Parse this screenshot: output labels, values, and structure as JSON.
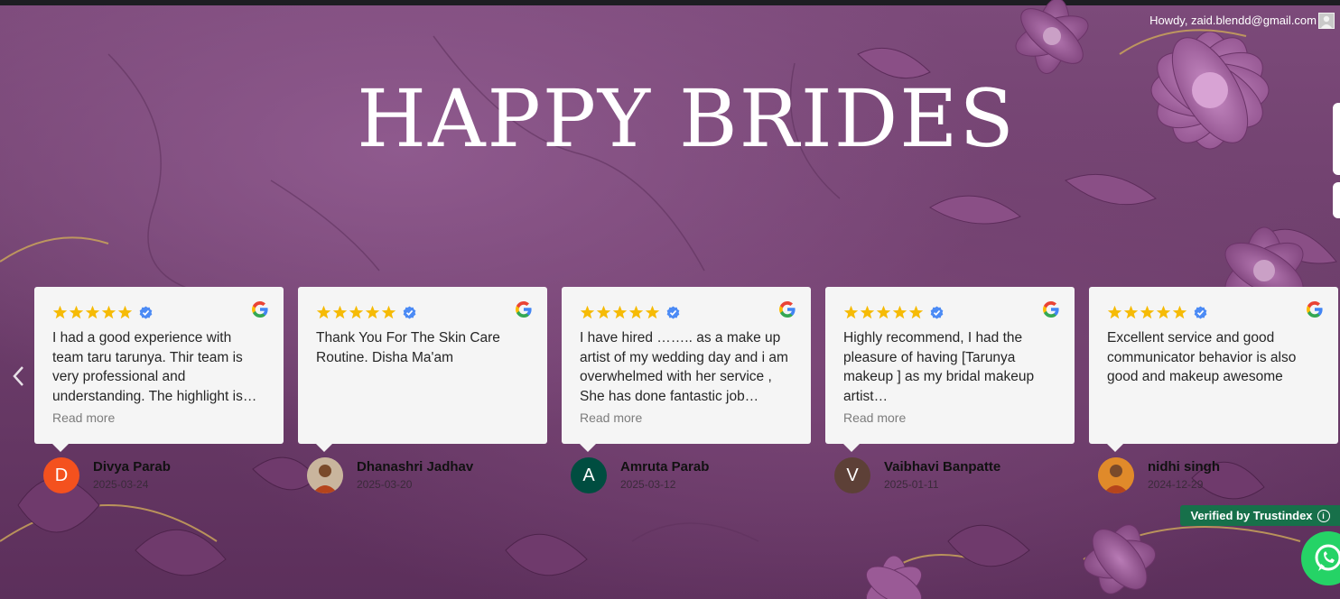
{
  "header": {
    "greeting": "Howdy, zaid.blendd@gmail.com"
  },
  "section": {
    "title": "HAPPY BRIDES"
  },
  "colors": {
    "background": "#6e3f6c",
    "card": "#f5f5f5",
    "star": "#f6bb06",
    "verified_blue": "#4c8bf5",
    "trustindex_green": "#17704a",
    "whatsapp_green": "#25d366"
  },
  "carousel": {
    "prev_icon": "chevron-left-icon",
    "reviews": [
      {
        "rating": 5,
        "text": "I had a good experience with team taru tarunya. Thir team is very professional and understanding. The highlight is…",
        "read_more": "Read more",
        "reviewer": "Divya Parab",
        "date": "2025-03-24",
        "avatar_initial": "D",
        "avatar_color": "#f4511e"
      },
      {
        "rating": 5,
        "text": "Thank You For The Skin Care Routine. Disha Ma'am",
        "read_more": "",
        "reviewer": "Dhanashri Jadhav",
        "date": "2025-03-20",
        "avatar_initial": "",
        "avatar_color": "#c9b59d"
      },
      {
        "rating": 5,
        "text": "I have hired …….. as a make up artist of my wedding day and i am overwhelmed with her service , She has done fantastic job…",
        "read_more": "Read more",
        "reviewer": "Amruta Parab",
        "date": "2025-03-12",
        "avatar_initial": "A",
        "avatar_color": "#004d40"
      },
      {
        "rating": 5,
        "text": "Highly recommend, I had the pleasure of having [Tarunya makeup ] as my bridal makeup artist…",
        "read_more": "Read more",
        "reviewer": "Vaibhavi Banpatte",
        "date": "2025-01-11",
        "avatar_initial": "V",
        "avatar_color": "#5d4037"
      },
      {
        "rating": 5,
        "text": "Excellent service and good communicator behavior is also good and makeup awesome",
        "read_more": "",
        "reviewer": "nidhi singh",
        "date": "2024-12-29",
        "avatar_initial": "",
        "avatar_color": "#e08a2a"
      }
    ]
  },
  "badge": {
    "label": "Verified by Trustindex",
    "info_icon": "info-icon"
  },
  "floating": {
    "whatsapp_icon": "whatsapp-icon"
  }
}
